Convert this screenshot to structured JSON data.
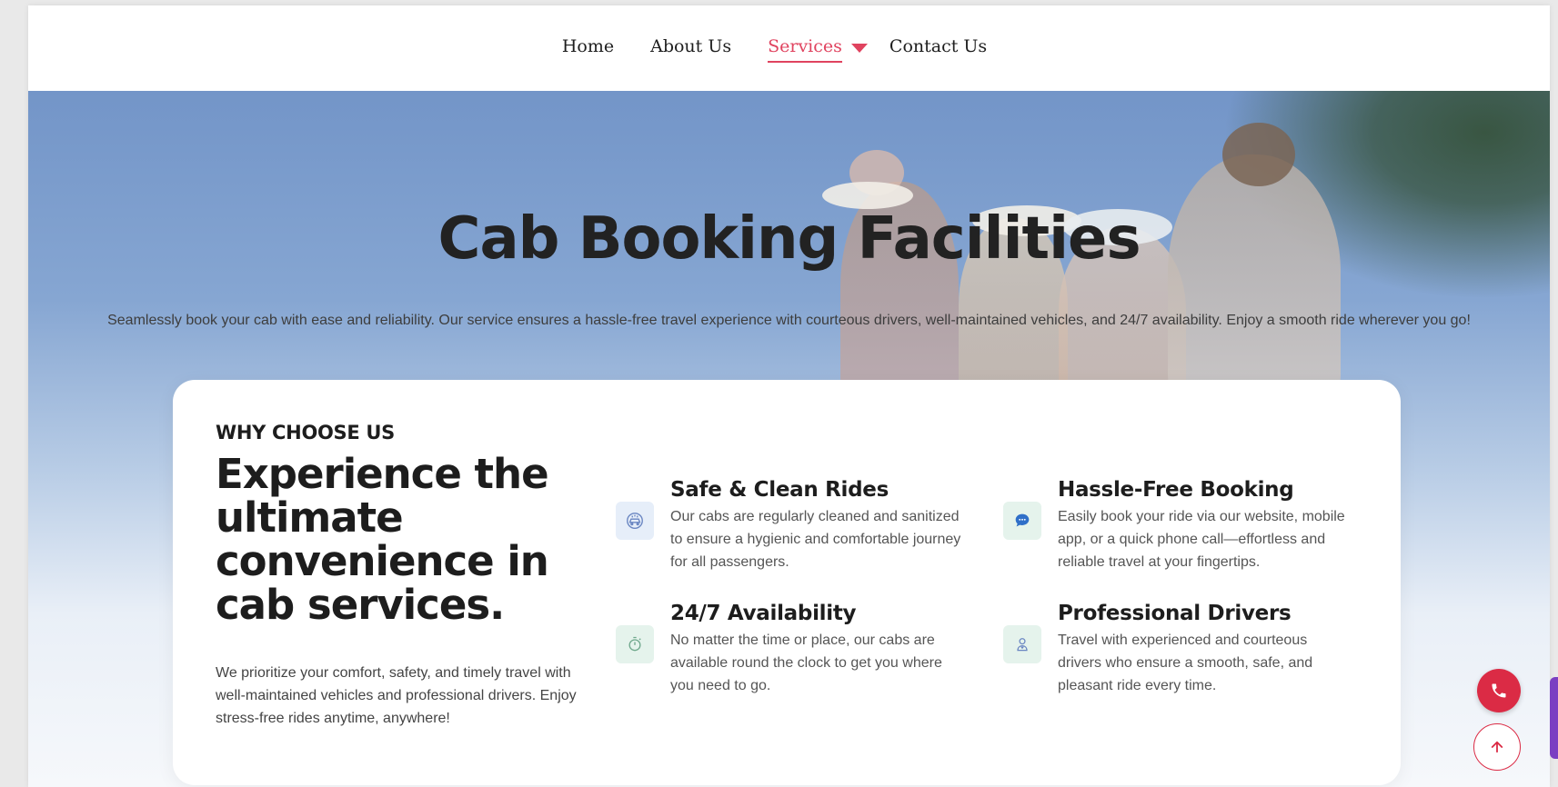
{
  "nav": {
    "items": [
      {
        "label": "Home",
        "active": false
      },
      {
        "label": "About Us",
        "active": false
      },
      {
        "label": "Services",
        "active": true
      },
      {
        "label": "Contact Us",
        "active": false
      }
    ]
  },
  "hero": {
    "title": "Cab Booking Facilities",
    "subtitle": "Seamlessly book your cab with ease and reliability. Our service ensures a hassle-free travel experience with courteous drivers, well-maintained vehicles, and 24/7 availability. Enjoy a smooth ride wherever you go!"
  },
  "why": {
    "eyebrow": "WHY CHOOSE US",
    "title": "Experience the ultimate convenience in cab services.",
    "description": "We prioritize your comfort, safety, and timely travel with well-maintained vehicles and professional drivers. Enjoy stress-free rides anytime, anywhere!",
    "features": [
      {
        "title": "Safe & Clean Rides",
        "text": "Our cabs are regularly cleaned and sanitized to ensure a hygienic and comfortable journey for all passengers.",
        "icon": "clean-car-icon"
      },
      {
        "title": "Hassle-Free Booking",
        "text": "Easily book your ride via our website, mobile app, or a quick phone call—effortless and reliable travel at your fingertips.",
        "icon": "chat-icon"
      },
      {
        "title": "24/7 Availability",
        "text": "No matter the time or place, our cabs are available round the clock to get you where you need to go.",
        "icon": "stopwatch-icon"
      },
      {
        "title": "Professional Drivers",
        "text": "Travel with experienced and courteous drivers who ensure a smooth, safe, and pleasant ride every time.",
        "icon": "driver-icon"
      }
    ]
  },
  "colors": {
    "accent": "#e0435f",
    "fab": "#db2b45"
  }
}
